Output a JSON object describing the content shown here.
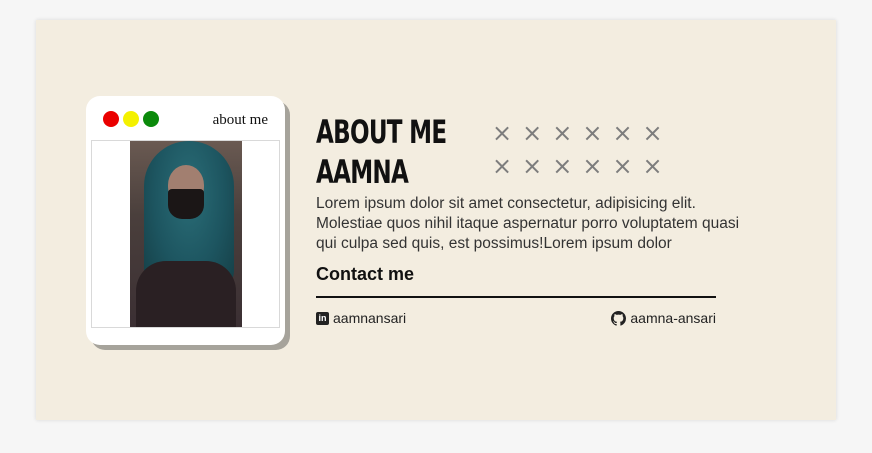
{
  "window": {
    "title": "about me",
    "dot_colors": [
      "#ea0000",
      "#f4f100",
      "#0b8a0b"
    ]
  },
  "heading": {
    "line1": "ABOUT ME",
    "line2": "AAMNA"
  },
  "decor": {
    "row1": "××××××",
    "row2": "××××××"
  },
  "bio": "Lorem ipsum dolor sit amet consectetur, adipisicing elit. Molestiae quos nihil itaque aspernatur porro voluptatem quasi qui culpa sed quis, est possimus!Lorem ipsum dolor",
  "contact": {
    "title": "Contact me",
    "linkedin": {
      "icon": "linkedin-icon",
      "label": "aamnansari"
    },
    "github": {
      "icon": "github-icon",
      "label": "aamna-ansari"
    }
  },
  "colors": {
    "card_bg": "#f3ede0",
    "accent_text": "#111111"
  }
}
